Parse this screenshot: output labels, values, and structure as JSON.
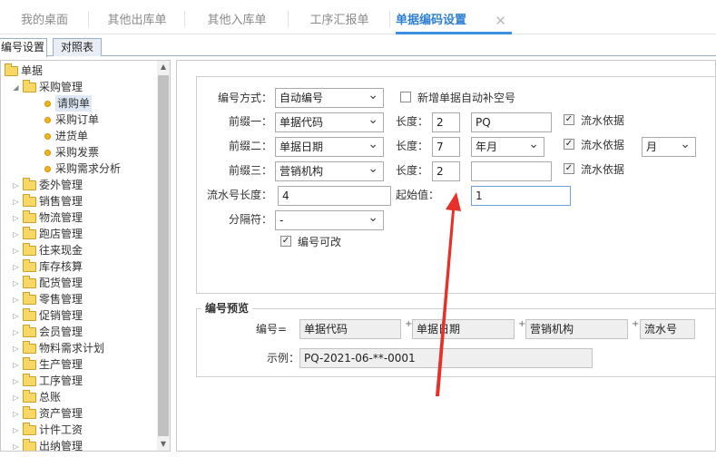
{
  "tabs": [
    {
      "label": "我的桌面"
    },
    {
      "label": "其他出库单"
    },
    {
      "label": "其他入库单"
    },
    {
      "label": "工序汇报单"
    },
    {
      "label": "单据编码设置",
      "close": "✕"
    }
  ],
  "subtabs": [
    {
      "label": "编号设置"
    },
    {
      "label": "对照表"
    }
  ],
  "tree": {
    "root": "单据",
    "group": "采购管理",
    "children": [
      "请购单",
      "采购订单",
      "进货单",
      "采购发票",
      "采购需求分析"
    ],
    "folders": [
      "委外管理",
      "销售管理",
      "物流管理",
      "跑店管理",
      "往来现金",
      "库存核算",
      "配货管理",
      "零售管理",
      "促销管理",
      "会员管理",
      "物料需求计划",
      "生产管理",
      "工序管理",
      "总账",
      "资产管理",
      "计件工资",
      "出纳管理"
    ]
  },
  "form": {
    "mode_label": "编号方式：",
    "mode_value": "自动编号",
    "autofill_label": "新增单据自动补空号",
    "p1_label": "前缀一：",
    "p1_value": "单据代码",
    "p2_label": "前缀二：",
    "p2_value": "单据日期",
    "p3_label": "前缀三：",
    "p3_value": "营销机构",
    "len_label": "长度：",
    "p1_len": "2",
    "p2_len": "7",
    "p3_len": "2",
    "p1_text": "PQ",
    "p2_fmt": "年月",
    "p3_text": "",
    "serial_basis": "流水依据",
    "p2_basis_select": "月",
    "serial_len_label": "流水号长度：",
    "serial_len": "4",
    "start_label": "起始值：",
    "start_value": "1",
    "sep_label": "分隔符：",
    "sep_value": "-",
    "editable_label": "编号可改"
  },
  "preview": {
    "legend": "编号预览",
    "code_label": "编号=",
    "parts": [
      "单据代码",
      "单据日期",
      "营销机构",
      "流水号"
    ],
    "plus": "+",
    "example_label": "示例：",
    "example_value": "PQ-2021-06-**-0001"
  },
  "colors": {
    "accent": "#3c8fe3",
    "annotation_arrow": "#e8302a"
  }
}
